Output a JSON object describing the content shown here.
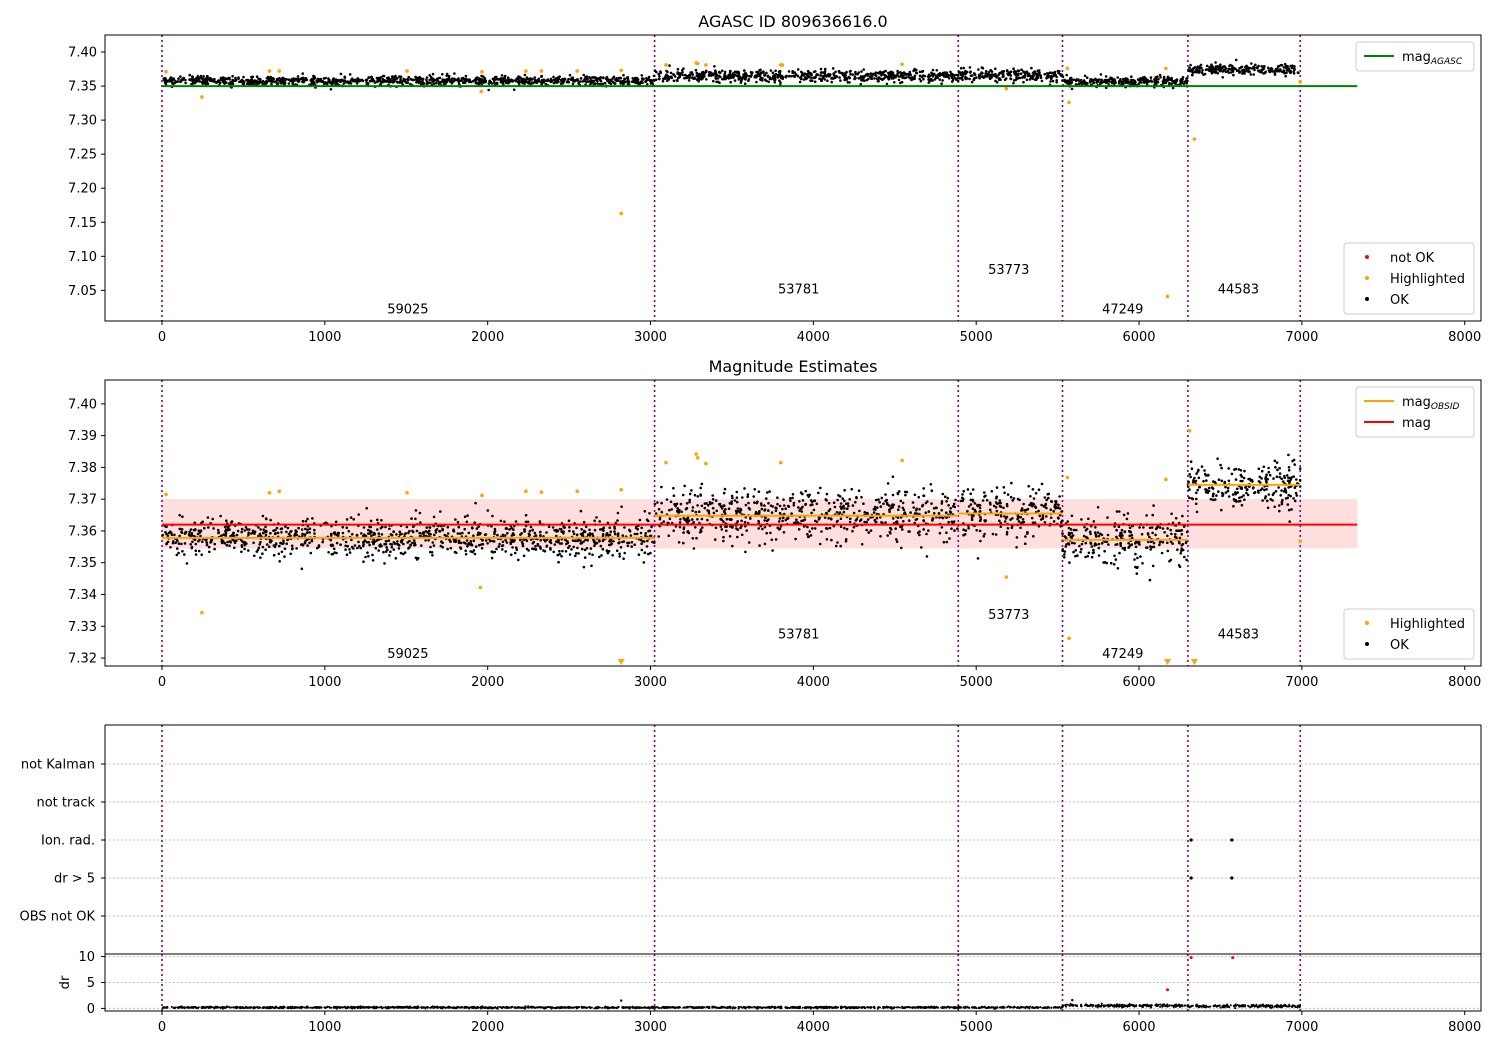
{
  "figure": {
    "background": "#ffffff"
  },
  "colors": {
    "ok": "#000000",
    "highlighted": "#ffa500",
    "not_ok": "#ff0000",
    "mag_agasc": "#008000",
    "mag_obsid": "#ffa500",
    "mag": "#ff0000",
    "mag_band": "#ffd6d6",
    "obsid_divider": "#800080",
    "grid": "#b0b0b0"
  },
  "chart_data": [
    {
      "id": "top",
      "type": "scatter",
      "title": "AGASC ID 809636616.0",
      "xlabel": "",
      "ylabel": "",
      "xlim": [
        -350,
        8100
      ],
      "ylim": [
        7.005,
        7.425
      ],
      "xticks": [
        0,
        1000,
        2000,
        3000,
        4000,
        5000,
        6000,
        7000,
        8000
      ],
      "yticks": [
        7.05,
        7.1,
        7.15,
        7.2,
        7.25,
        7.3,
        7.35,
        7.4
      ],
      "obsid_boundaries": [
        0,
        3025,
        4890,
        5530,
        6300,
        6990
      ],
      "obsids": [
        {
          "label": "59025",
          "x": 1510,
          "y": 7.022
        },
        {
          "label": "53781",
          "x": 3910,
          "y": 7.051
        },
        {
          "label": "53773",
          "x": 5200,
          "y": 7.08
        },
        {
          "label": "47249",
          "x": 5900,
          "y": 7.022
        },
        {
          "label": "44583",
          "x": 6610,
          "y": 7.051
        }
      ],
      "series": [
        {
          "name": "OK",
          "kind": "band",
          "segments": [
            {
              "x0": 0,
              "x1": 3025,
              "center": 7.358,
              "spread": 0.006
            },
            {
              "x0": 3025,
              "x1": 4890,
              "center": 7.365,
              "spread": 0.008
            },
            {
              "x0": 4890,
              "x1": 5530,
              "center": 7.366,
              "spread": 0.008
            },
            {
              "x0": 5530,
              "x1": 6300,
              "center": 7.357,
              "spread": 0.007
            },
            {
              "x0": 6300,
              "x1": 6990,
              "center": 7.374,
              "spread": 0.007
            }
          ]
        },
        {
          "name": "Highlighted",
          "kind": "points",
          "x": [
            25,
            245,
            660,
            720,
            1505,
            1960,
            1965,
            2235,
            2330,
            2550,
            2820,
            2820,
            3095,
            3280,
            3290,
            3340,
            3800,
            3810,
            4545,
            5185,
            5560,
            5570,
            6165,
            6175,
            6340,
            6990
          ],
          "y": [
            7.371,
            7.334,
            7.372,
            7.372,
            7.372,
            7.342,
            7.371,
            7.372,
            7.372,
            7.372,
            7.373,
            7.163,
            7.381,
            7.384,
            7.383,
            7.381,
            7.381,
            7.381,
            7.382,
            7.346,
            7.376,
            7.326,
            7.376,
            7.041,
            7.272,
            7.356
          ]
        },
        {
          "name": "not OK",
          "kind": "points",
          "x": [],
          "y": []
        },
        {
          "name": "magAGASC",
          "kind": "hline",
          "y": 7.35,
          "x0": 0,
          "x1": 7340
        }
      ],
      "legends": [
        {
          "position": "upper-right",
          "entries": [
            {
              "label": "mag",
              "sub": "AGASC",
              "marker": "line",
              "color": "#008000"
            }
          ]
        },
        {
          "position": "lower-right",
          "entries": [
            {
              "label": "not OK",
              "marker": "dot",
              "color": "#ff0000"
            },
            {
              "label": "Highlighted",
              "marker": "dot",
              "color": "#ffa500"
            },
            {
              "label": "OK",
              "marker": "dot",
              "color": "#000000"
            }
          ]
        }
      ]
    },
    {
      "id": "middle",
      "type": "scatter",
      "title": "Magnitude Estimates",
      "xlabel": "",
      "ylabel": "",
      "xlim": [
        -350,
        8100
      ],
      "ylim": [
        7.3175,
        7.4075
      ],
      "xticks": [
        0,
        1000,
        2000,
        3000,
        4000,
        5000,
        6000,
        7000,
        8000
      ],
      "yticks": [
        7.32,
        7.33,
        7.34,
        7.35,
        7.36,
        7.37,
        7.38,
        7.39,
        7.4
      ],
      "obsid_boundaries": [
        0,
        3025,
        4890,
        5530,
        6300,
        6990
      ],
      "obsids": [
        {
          "label": "59025",
          "x": 1510,
          "y": 7.3212
        },
        {
          "label": "53781",
          "x": 3910,
          "y": 7.3274
        },
        {
          "label": "53773",
          "x": 5200,
          "y": 7.3336
        },
        {
          "label": "47249",
          "x": 5900,
          "y": 7.3212
        },
        {
          "label": "44583",
          "x": 6610,
          "y": 7.3274
        }
      ],
      "mag": 7.362,
      "mag_band": [
        7.3545,
        7.37
      ],
      "mag_line_x": [
        0,
        7340
      ],
      "mag_obsid": [
        {
          "x0": 0,
          "x1": 3025,
          "y": 7.3578
        },
        {
          "x0": 3025,
          "x1": 4890,
          "y": 7.3648
        },
        {
          "x0": 4890,
          "x1": 5530,
          "y": 7.3655
        },
        {
          "x0": 5530,
          "x1": 6300,
          "y": 7.3572
        },
        {
          "x0": 6300,
          "x1": 6990,
          "y": 7.3745
        }
      ],
      "series": [
        {
          "name": "OK",
          "kind": "band",
          "segments": [
            {
              "x0": 0,
              "x1": 3025,
              "center": 7.3578,
              "spread": 0.0055
            },
            {
              "x0": 3025,
              "x1": 4890,
              "center": 7.3648,
              "spread": 0.0075
            },
            {
              "x0": 4890,
              "x1": 5530,
              "center": 7.3655,
              "spread": 0.0075
            },
            {
              "x0": 5530,
              "x1": 6300,
              "center": 7.3572,
              "spread": 0.007
            },
            {
              "x0": 6300,
              "x1": 6990,
              "center": 7.3745,
              "spread": 0.0065
            }
          ]
        },
        {
          "name": "Highlighted",
          "kind": "points",
          "x": [
            25,
            245,
            660,
            720,
            1505,
            1965,
            1955,
            2235,
            2330,
            2550,
            2820,
            3095,
            3280,
            3290,
            3340,
            3800,
            4545,
            5185,
            5560,
            5570,
            6165,
            6310,
            6990
          ],
          "y": [
            7.3715,
            7.3343,
            7.372,
            7.3725,
            7.372,
            7.3712,
            7.3422,
            7.3725,
            7.3722,
            7.3725,
            7.373,
            7.3815,
            7.3842,
            7.383,
            7.3812,
            7.3815,
            7.3822,
            7.3455,
            7.3768,
            7.3262,
            7.3762,
            7.3915,
            7.3568
          ]
        },
        {
          "name": "Highlighted (off-axis)",
          "kind": "markers",
          "x": [
            2820,
            6175,
            6340
          ]
        }
      ],
      "legends": [
        {
          "position": "upper-right",
          "entries": [
            {
              "label": "mag",
              "sub": "OBSID",
              "marker": "line",
              "color": "#ffa500"
            },
            {
              "label": "mag",
              "marker": "line",
              "color": "#ff0000"
            }
          ]
        },
        {
          "position": "lower-right",
          "entries": [
            {
              "label": "Highlighted",
              "marker": "dot",
              "color": "#ffa500"
            },
            {
              "label": "OK",
              "marker": "dot",
              "color": "#000000"
            }
          ]
        }
      ]
    },
    {
      "id": "flags",
      "type": "scatter",
      "title": "",
      "xlim": [
        -350,
        8100
      ],
      "categories": [
        "not Kalman",
        "not track",
        "Ion. rad.",
        "dr > 5",
        "OBS not OK"
      ],
      "obsid_boundaries": [
        0,
        3025,
        4890,
        5530,
        6300,
        6990
      ],
      "series": [
        {
          "name": "Ion. rad.",
          "x": [
            6320,
            6570
          ],
          "color": [
            "#000000",
            "#000000"
          ]
        },
        {
          "name": "dr > 5",
          "x": [
            6320,
            6570
          ],
          "color": [
            "#000000",
            "#000000"
          ]
        }
      ]
    },
    {
      "id": "dr",
      "type": "scatter",
      "title": "",
      "ylabel": "dr",
      "xlim": [
        -350,
        8100
      ],
      "ylim": [
        -0.5,
        10.5
      ],
      "xticks": [
        0,
        1000,
        2000,
        3000,
        4000,
        5000,
        6000,
        7000,
        8000
      ],
      "yticks": [
        0,
        5,
        10
      ],
      "obsid_boundaries": [
        0,
        3025,
        4890,
        5530,
        6300,
        6990
      ],
      "series": [
        {
          "name": "OK",
          "kind": "band",
          "segments": [
            {
              "x0": 0,
              "x1": 5530,
              "center": 0.18,
              "spread": 0.15
            },
            {
              "x0": 5530,
              "x1": 6300,
              "center": 0.55,
              "spread": 0.25
            },
            {
              "x0": 6300,
              "x1": 6990,
              "center": 0.45,
              "spread": 0.25
            }
          ]
        },
        {
          "name": "OK outliers",
          "kind": "points",
          "x": [
            2820,
            5590
          ],
          "y": [
            1.5,
            1.6
          ]
        },
        {
          "name": "not OK",
          "kind": "points",
          "x": [
            6175,
            6320,
            6575
          ],
          "y": [
            3.6,
            9.8,
            9.8
          ]
        }
      ]
    }
  ]
}
